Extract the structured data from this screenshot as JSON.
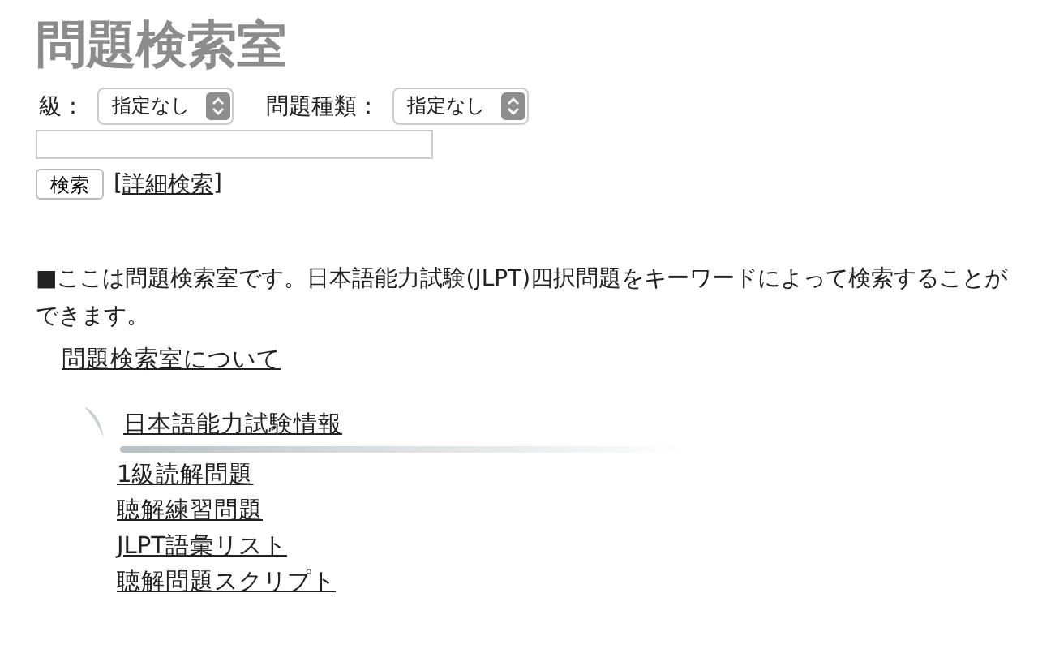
{
  "title": "問題検索室",
  "filters": [
    {
      "label": "級：",
      "value": "指定なし"
    },
    {
      "label": "問題種類：",
      "value": "指定なし"
    }
  ],
  "search_button": "検索",
  "advanced_link": {
    "open": "[",
    "text": "詳細検索",
    "close": "]"
  },
  "intro": "■ここは問題検索室です。日本語能力試験(JLPT)四択問題をキーワードによって検索することができます。",
  "about_link": "問題検索室について",
  "section": {
    "heading": "日本語能力試験情報",
    "links": [
      "1級読解問題",
      "聴解練習問題",
      "JLPT語彙リスト",
      "聴解問題スクリプト"
    ]
  }
}
